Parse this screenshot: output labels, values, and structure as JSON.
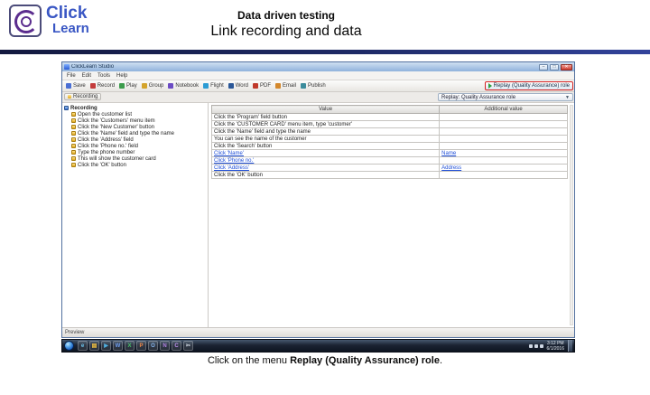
{
  "slide": {
    "logo": {
      "top": "Click",
      "bottom": "Learn"
    },
    "title": "Data driven testing",
    "subtitle": "Link recording and data",
    "caption": {
      "prefix": "Click on the menu ",
      "bold": "Replay (Quality Assurance) role",
      "suffix": "."
    }
  },
  "colors": {
    "divider_navy": "#1e2a66",
    "highlight_red": "#d42020",
    "link_blue": "#1f4fd8",
    "logo_blue": "#3a57c4",
    "logo_purple": "#5b2d8e"
  },
  "window": {
    "title": "ClickLearn Studio",
    "titlebar_buttons": {
      "minimize": "–",
      "maximize": "□",
      "close": "✕"
    },
    "menu_items": [
      "File",
      "Edit",
      "Tools",
      "Help"
    ],
    "toolbar_items": [
      {
        "label": "Save",
        "color": "#4a6fd4"
      },
      {
        "label": "Record",
        "color": "#c43c3c"
      },
      {
        "label": "Play",
        "color": "#3c9c4c"
      },
      {
        "label": "Group",
        "color": "#d4a42c"
      },
      {
        "label": "Notebook",
        "color": "#6c4cc4"
      },
      {
        "label": "Flight",
        "color": "#2c9cd4"
      },
      {
        "label": "Word",
        "color": "#2b5797"
      },
      {
        "label": "PDF",
        "color": "#c0392b"
      },
      {
        "label": "Email",
        "color": "#d4882c"
      },
      {
        "label": "Publish",
        "color": "#3c8c9c"
      }
    ],
    "replay_button": "Replay (Quality Assurance) role",
    "recording_chip": "Recording",
    "replay_dropdown": "Replay: Quality Assurance role",
    "dropdown_arrow": "▼",
    "tree_items": [
      {
        "label": "Recording",
        "root": true
      },
      {
        "label": "Open the customer list"
      },
      {
        "label": "Click the 'Customers' menu item"
      },
      {
        "label": "Click the 'New Customer' button"
      },
      {
        "label": "Click the 'Name' field and type the name"
      },
      {
        "label": "Click the 'Address' field"
      },
      {
        "label": "Click the 'Phone no.' field"
      },
      {
        "label": "Type the phone number"
      },
      {
        "label": "This will show the customer card"
      },
      {
        "label": "Click the 'OK' button"
      }
    ],
    "table": {
      "headers": [
        "Value",
        "Additional value"
      ],
      "rows": [
        {
          "value": "Click the 'Program' field button",
          "value_link": false,
          "extra": "",
          "extra_link": false
        },
        {
          "value": "Click the 'CUSTOMER CARD' menu item, type 'customer'",
          "value_link": false,
          "extra": "",
          "extra_link": false
        },
        {
          "value": "Click the 'Name' field and type the name",
          "value_link": false,
          "extra": "",
          "extra_link": false
        },
        {
          "value": "You can see the name of the customer",
          "value_link": false,
          "extra": "",
          "extra_link": false
        },
        {
          "value": "Click the 'Search' button",
          "value_link": false,
          "extra": "",
          "extra_link": false
        },
        {
          "value": "Click 'Name'",
          "value_link": true,
          "extra": "Name",
          "extra_link": true
        },
        {
          "value": "Click 'Phone no.'",
          "value_link": true,
          "extra": "",
          "extra_link": false
        },
        {
          "value": "Click 'Address'",
          "value_link": true,
          "extra": "Address",
          "extra_link": true
        },
        {
          "value": "Click the 'OK' button",
          "value_link": false,
          "extra": "",
          "extra_link": false
        }
      ]
    },
    "status": "Preview"
  },
  "taskbar": {
    "icons": [
      {
        "name": "internet-explorer-icon",
        "glyph": "e",
        "color": "#6ec6f0"
      },
      {
        "name": "explorer-folder-icon",
        "glyph": "▤",
        "color": "#f0c040"
      },
      {
        "name": "media-player-icon",
        "glyph": "▶",
        "color": "#50b0e0"
      },
      {
        "name": "word-icon",
        "glyph": "W",
        "color": "#6f9ff0"
      },
      {
        "name": "excel-icon",
        "glyph": "X",
        "color": "#48c068"
      },
      {
        "name": "powerpoint-icon",
        "glyph": "P",
        "color": "#f08848"
      },
      {
        "name": "outlook-icon",
        "glyph": "O",
        "color": "#88b8f0"
      },
      {
        "name": "onenote-icon",
        "glyph": "N",
        "color": "#b080e0"
      },
      {
        "name": "clicklearn-icon",
        "glyph": "C",
        "color": "#c090f0"
      },
      {
        "name": "snipping-tool-icon",
        "glyph": "✂",
        "color": "#d8e0ea"
      }
    ],
    "clock": {
      "time": "3:12 PM",
      "date": "6/1/2016"
    }
  }
}
